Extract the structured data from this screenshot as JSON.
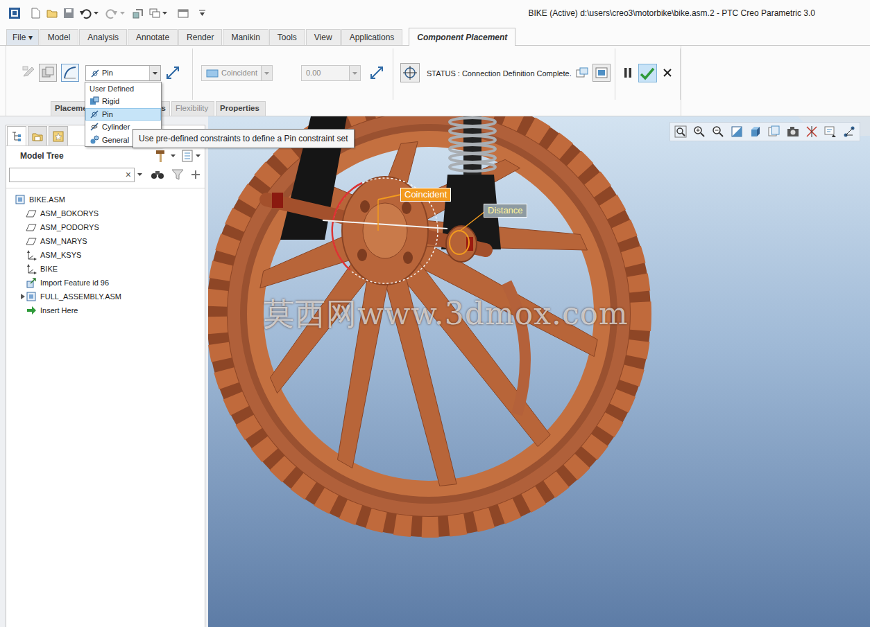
{
  "window": {
    "title": "BIKE (Active) d:\\users\\creo3\\motorbike\\bike.asm.2 - PTC Creo Parametric 3.0"
  },
  "ribbon_tabs": [
    {
      "label": "File ▾",
      "selected": false
    },
    {
      "label": "Model",
      "selected": false
    },
    {
      "label": "Analysis",
      "selected": false
    },
    {
      "label": "Annotate",
      "selected": false
    },
    {
      "label": "Render",
      "selected": false
    },
    {
      "label": "Manikin",
      "selected": false
    },
    {
      "label": "Tools",
      "selected": false
    },
    {
      "label": "View",
      "selected": false
    },
    {
      "label": "Applications",
      "selected": false
    },
    {
      "label": "Component Placement",
      "selected": true
    }
  ],
  "placement": {
    "connection_type": "Pin",
    "constraint": {
      "value": "Coincident",
      "disabled": true
    },
    "offset": {
      "value": "0.00",
      "disabled": true
    },
    "status": "STATUS : Connection Definition Complete."
  },
  "subtabs": [
    {
      "label": "Placeme",
      "disabled": false
    },
    {
      "label": "s",
      "disabled": false
    },
    {
      "label": "Flexibility",
      "disabled": true
    },
    {
      "label": "Properties",
      "disabled": false
    }
  ],
  "connection_menu": {
    "header": "User Defined",
    "items": [
      {
        "label": "Rigid",
        "kind": "rigid",
        "selected": false
      },
      {
        "label": "Pin",
        "kind": "pin",
        "selected": true
      },
      {
        "label": "Cylinder",
        "kind": "cylinder",
        "selected": false
      },
      {
        "label": "General",
        "kind": "general",
        "selected": false
      }
    ]
  },
  "tooltip": "Use pre-defined constraints to define a Pin constraint set",
  "navigator_tabs": [
    {
      "kind": "tree",
      "selected": true
    },
    {
      "kind": "folder",
      "selected": false
    },
    {
      "kind": "favorites",
      "selected": false
    }
  ],
  "model_tree": {
    "title": "Model Tree",
    "search": {
      "value": "",
      "clear": "×"
    },
    "items": [
      {
        "label": "BIKE.ASM",
        "kind": "assembly",
        "depth": 0
      },
      {
        "label": "ASM_BOKORYS",
        "kind": "plane",
        "depth": 1
      },
      {
        "label": "ASM_PODORYS",
        "kind": "plane",
        "depth": 1
      },
      {
        "label": "ASM_NARYS",
        "kind": "plane",
        "depth": 1
      },
      {
        "label": "ASM_KSYS",
        "kind": "csys",
        "depth": 1
      },
      {
        "label": "BIKE",
        "kind": "csys",
        "depth": 1
      },
      {
        "label": "Import Feature id 96",
        "kind": "import",
        "depth": 1
      },
      {
        "label": "FULL_ASSEMBLY.ASM",
        "kind": "subassembly",
        "depth": 1,
        "expanded": false
      },
      {
        "label": "Insert Here",
        "kind": "insert",
        "depth": 1
      }
    ]
  },
  "viewport": {
    "labels": [
      {
        "text": "Coincident",
        "color": "#f39a1e"
      },
      {
        "text": "Distance",
        "color": "#8d9aa1"
      }
    ],
    "watermark": "莫西网www.3dmox.com"
  }
}
